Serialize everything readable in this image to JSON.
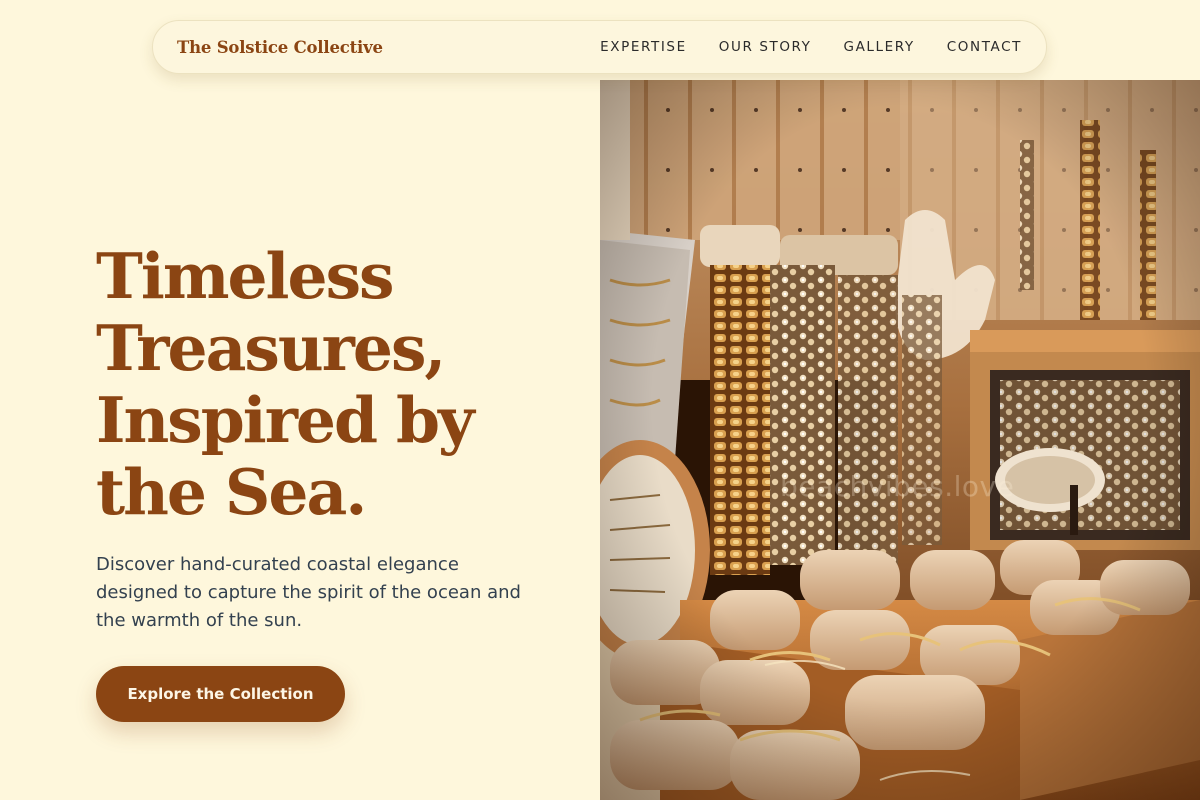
{
  "brand": {
    "name": "The Solstice Collective"
  },
  "nav": {
    "links": [
      "EXPERTISE",
      "OUR STORY",
      "GALLERY",
      "CONTACT"
    ]
  },
  "hero": {
    "title_lines": [
      "Timeless",
      "Treasures,",
      "Inspired by",
      "the Sea."
    ],
    "description": "Discover hand-curated coastal elegance designed to capture the spirit of the ocean and the warmth of the sun.",
    "cta_label": "Explore the Collection",
    "image_watermark": "beachvibes.love"
  },
  "colors": {
    "background": "#fef7dc",
    "brand": "#8b4513",
    "body_text": "#33414f",
    "nav_text": "#2b2b2b"
  },
  "icons": [
    "jewelry-display-photo"
  ]
}
